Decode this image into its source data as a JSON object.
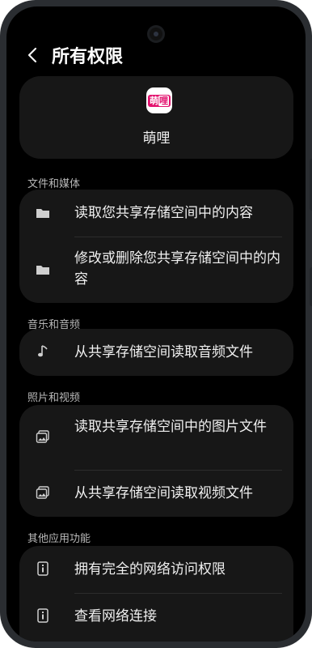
{
  "header": {
    "title": "所有权限"
  },
  "app": {
    "name": "萌哩",
    "icon_text_a": "萌",
    "icon_text_b": "哩"
  },
  "sections": [
    {
      "title": "文件和媒体",
      "items": [
        "读取您共享存储空间中的内容",
        "修改或删除您共享存储空间中的内容"
      ]
    },
    {
      "title": "音乐和音频",
      "items": [
        "从共享存储空间读取音频文件"
      ]
    },
    {
      "title": "照片和视频",
      "items": [
        "读取共享存储空间中的图片文件",
        "从共享存储空间读取视频文件"
      ]
    },
    {
      "title": "其他应用功能",
      "items": [
        "拥有完全的网络访问权限",
        "查看网络连接"
      ]
    }
  ],
  "icons": [
    "back-arrow-icon",
    "folder-icon",
    "music-note-icon",
    "image-icon",
    "info-icon"
  ],
  "colors": {
    "background": "#000000",
    "card": "#171717",
    "text": "#f0f0f0",
    "section_text": "#b9b9b9",
    "app_brand": "#e3126e"
  }
}
